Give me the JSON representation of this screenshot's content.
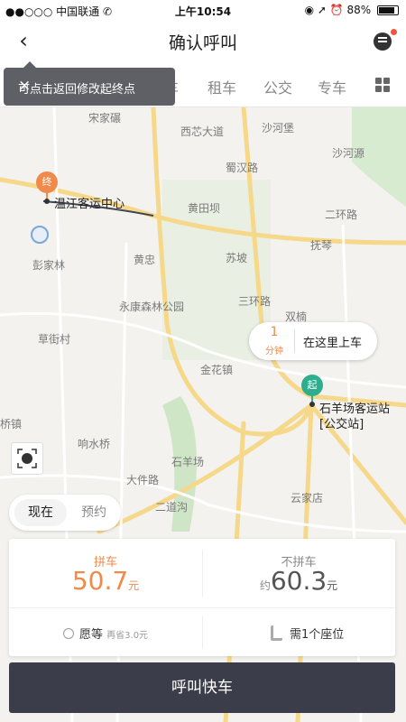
{
  "status": {
    "carrier": "●●○○○ 中国联通 ✆",
    "time": "上午10:54",
    "icons": "◉ ➚ ⏰",
    "battery": "88%",
    "battery_level": 0.88
  },
  "header": {
    "title": "确认呼叫"
  },
  "tabs": [
    "车",
    "租车",
    "公交",
    "专车"
  ],
  "tooltip": {
    "text": "可点击返回修改起终点",
    "close": "×"
  },
  "map": {
    "end_pin": "终",
    "start_pin": "起",
    "end_name": "温江客运中心",
    "start_name": "石羊场客运站",
    "start_sub": "[公交站]",
    "labels": [
      "宋家碾",
      "西芯大道",
      "沙河堡",
      "蜀汉路",
      "黄田坝",
      "二环路",
      "沙河源",
      "黄忠",
      "抚琴",
      "苏坡",
      "三环路",
      "永康森林公园",
      "双楠",
      "草街村",
      "金花镇",
      "石羊场",
      "大件路",
      "二道沟",
      "云家店",
      "桥镇",
      "响水桥",
      "彭家林",
      "八里"
    ],
    "pickup": {
      "num": "1",
      "unit": "分钟",
      "text": "在这里上车"
    }
  },
  "time_options": {
    "now": "现在",
    "reserve": "预约"
  },
  "fare": {
    "carpool_label": "拼车",
    "carpool_price": "50.7",
    "currency": "元",
    "solo_label": "不拼车",
    "solo_prefix": "约",
    "solo_price": "60.3",
    "wait_label": "愿等",
    "wait_save": "再省3.0元",
    "seat_label": "需1个座位"
  },
  "cta": "呼叫快车"
}
